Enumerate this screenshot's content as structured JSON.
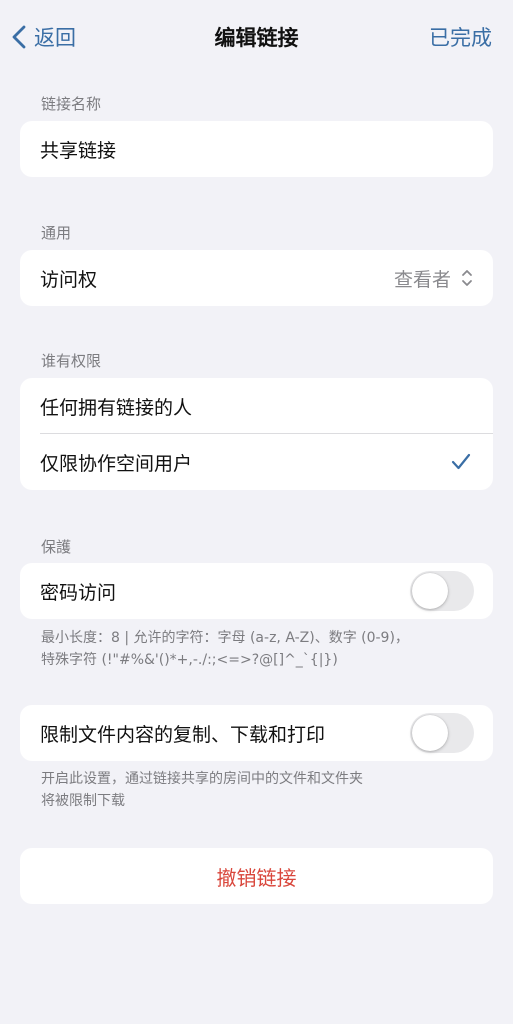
{
  "navbar": {
    "back_label": "返回",
    "title": "编辑链接",
    "done_label": "已完成"
  },
  "link_name": {
    "header": "链接名称",
    "value": "共享链接"
  },
  "general": {
    "header": "通用",
    "access_label": "访问权",
    "access_value": "查看者"
  },
  "permissions": {
    "header": "谁有权限",
    "options": [
      {
        "label": "任何拥有链接的人",
        "selected": false
      },
      {
        "label": "仅限协作空间用户",
        "selected": true
      }
    ]
  },
  "protection": {
    "header": "保護",
    "password_label": "密码访问",
    "password_enabled": false,
    "password_note_line1": "最小长度：8 | 允许的字符：字母 (a-z, A-Z)、数字 (0-9)，",
    "password_note_line2": "特殊字符 (!\"#%&'()*+,-./:;<=>?@[]^_`{|})"
  },
  "restrict": {
    "label": "限制文件内容的复制、下载和打印",
    "enabled": false,
    "note_line1": "开启此设置，通过链接共享的房间中的文件和文件夹",
    "note_line2": "将被限制下载"
  },
  "revoke": {
    "label": "撤销链接"
  },
  "colors": {
    "accent": "#3a6ea5",
    "destructive": "#d9463b",
    "background": "#f2f2f7",
    "secondary_text": "#7c7c80"
  }
}
